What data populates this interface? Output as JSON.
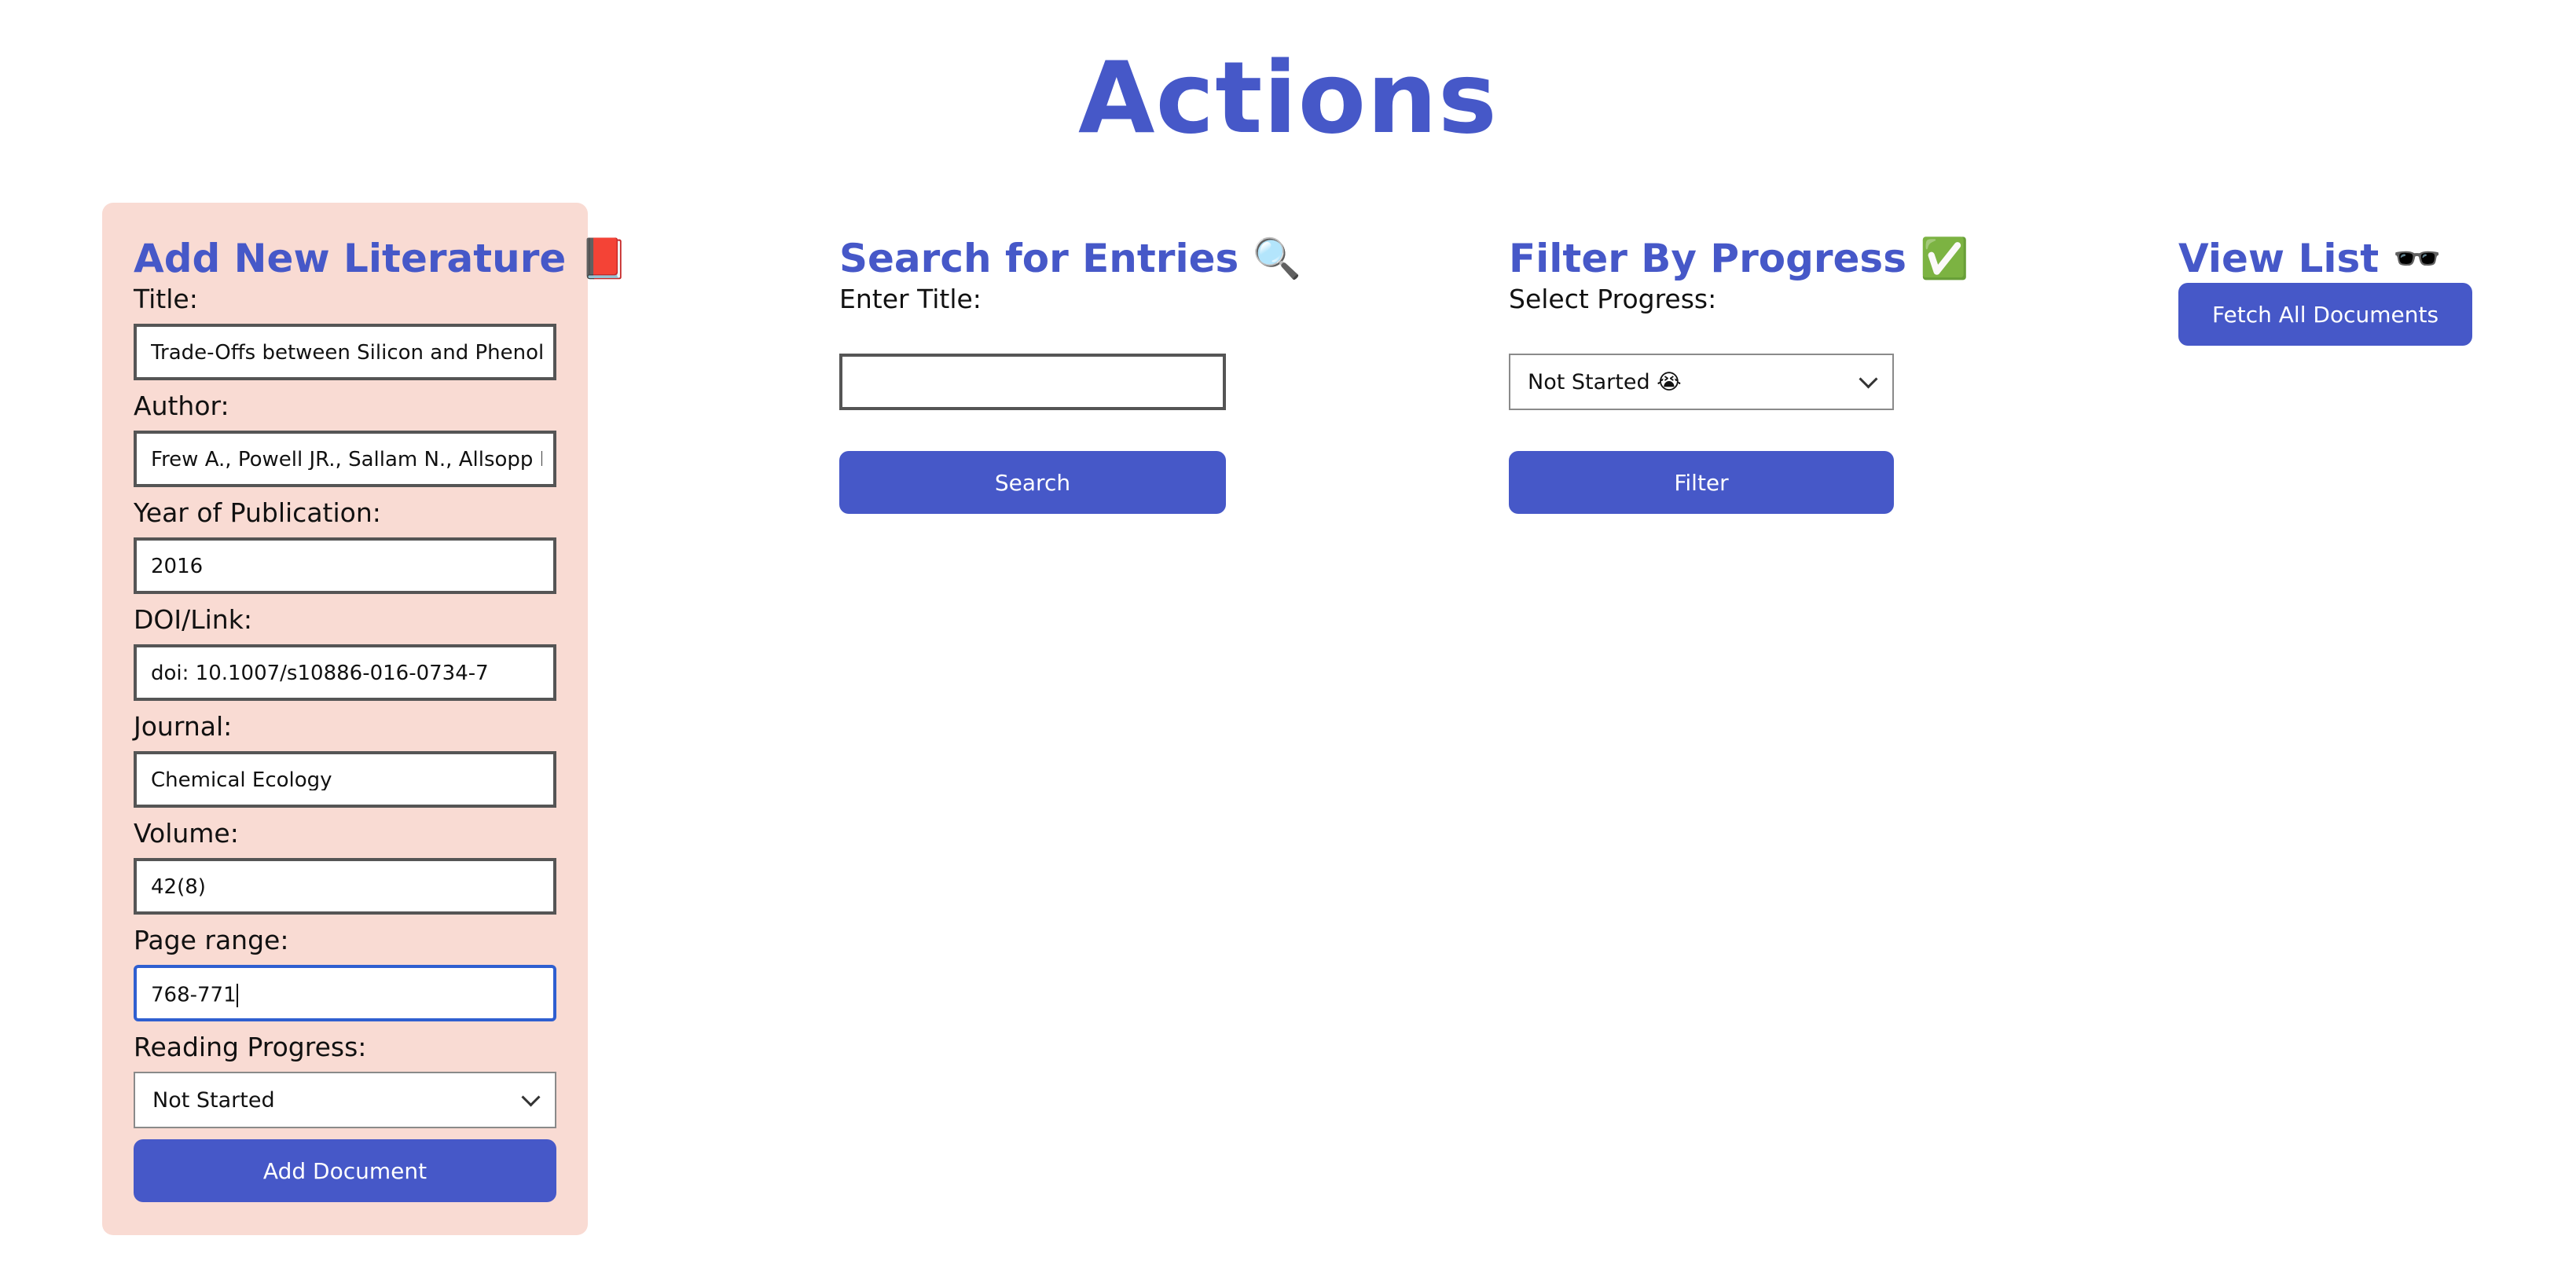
{
  "page": {
    "title": "Actions"
  },
  "add_panel": {
    "heading": "Add New Literature 📕",
    "title_label": "Title:",
    "title_value": "Trade-Offs between Silicon and Phenolic Defenses",
    "author_label": "Author:",
    "author_value": "Frew A., Powell JR., Sallam N., Allsopp PG., Johnson SN.",
    "year_label": "Year of Publication:",
    "year_value": "2016",
    "doi_label": "DOI/Link:",
    "doi_value": "doi: 10.1007/s10886-016-0734-7",
    "journal_label": "Journal:",
    "journal_value": "Chemical Ecology",
    "volume_label": "Volume:",
    "volume_value": "42(8)",
    "pages_label": "Page range:",
    "pages_value": "768-771",
    "progress_label": "Reading Progress:",
    "progress_value": "Not Started",
    "add_button": "Add Document"
  },
  "search_panel": {
    "heading": "Search for Entries 🔍",
    "label": "Enter Title:",
    "input_value": "",
    "button": "Search"
  },
  "filter_panel": {
    "heading": "Filter By Progress ✅",
    "label": "Select Progress:",
    "selected": "Not Started 😭",
    "button": "Filter"
  },
  "view_panel": {
    "heading": "View List 🕶️",
    "button": "Fetch All Documents"
  },
  "colors": {
    "accent": "#4658c8",
    "panel_bg": "#f9dbd3",
    "focus_border": "#2f5fd0"
  }
}
